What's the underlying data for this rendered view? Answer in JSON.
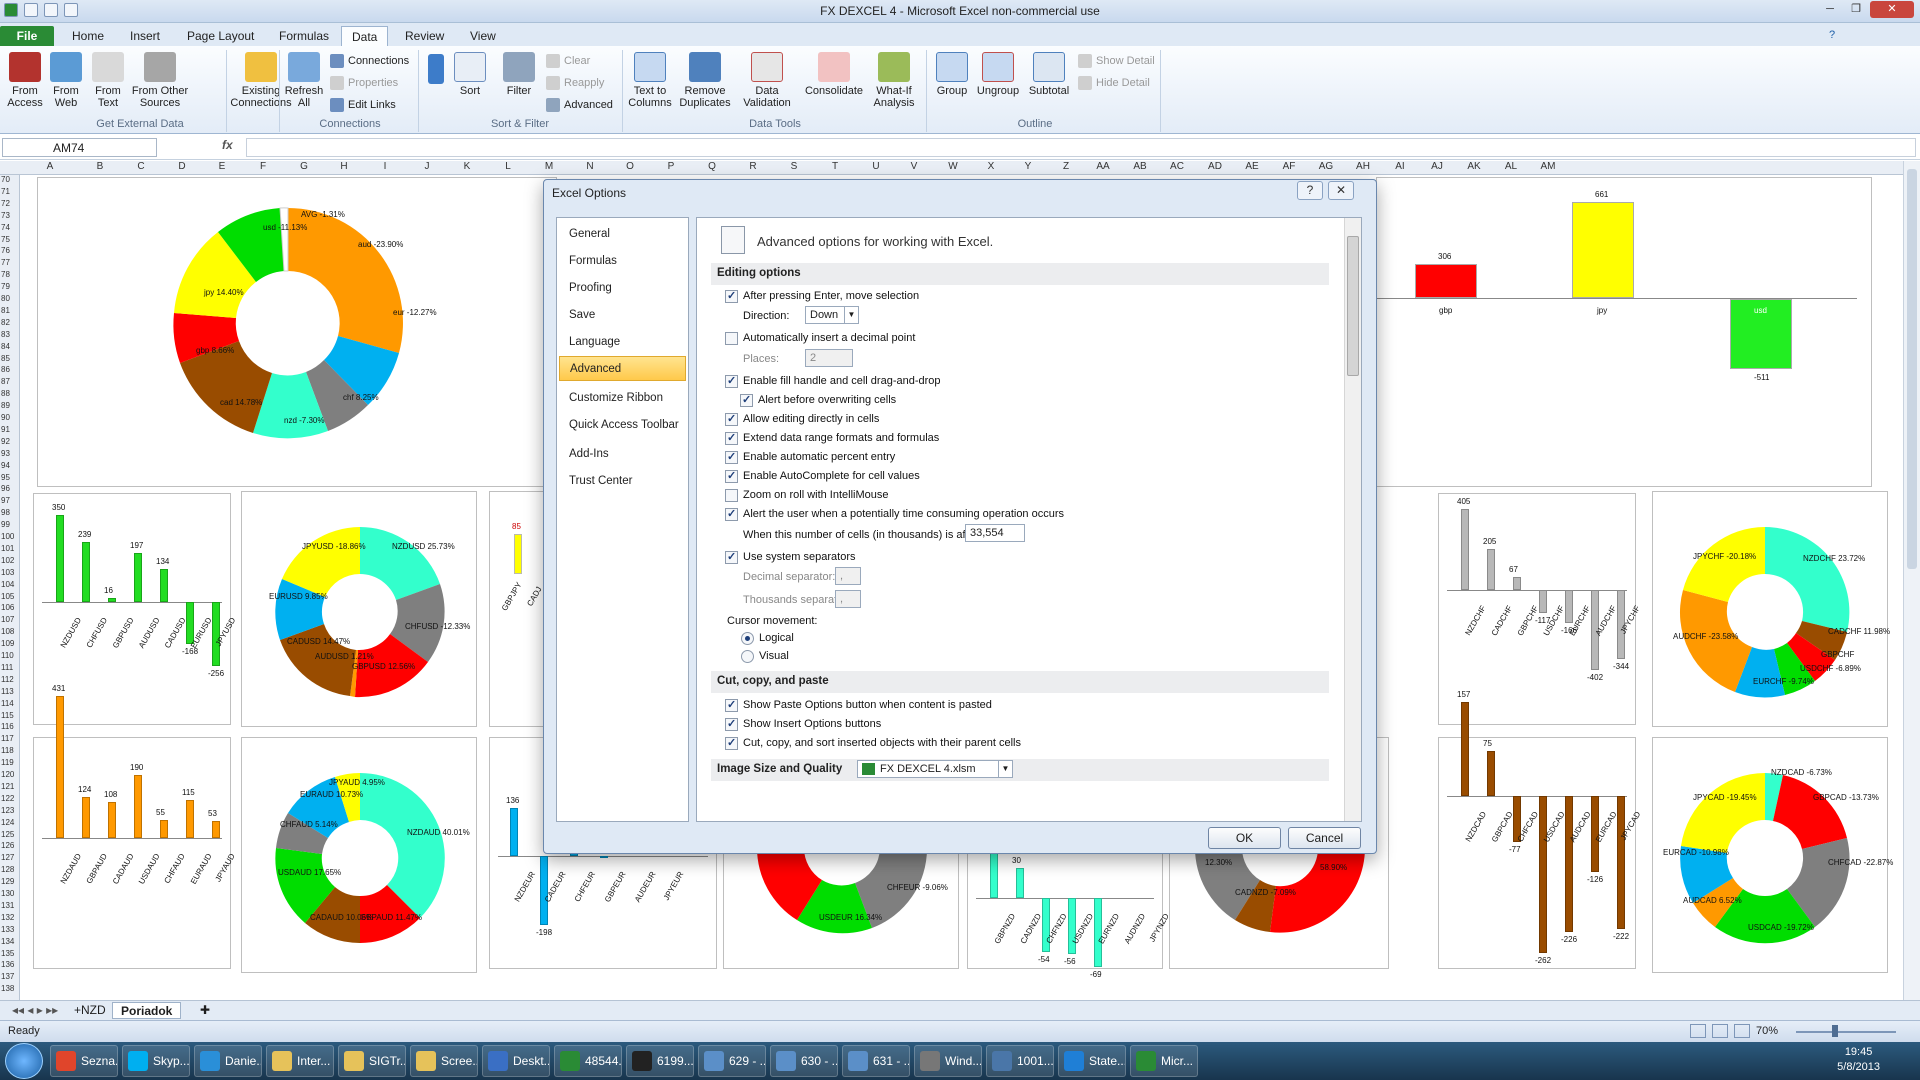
{
  "window": {
    "title": "FX DEXCEL 4  -  Microsoft Excel non-commercial use"
  },
  "tabs": [
    "File",
    "Home",
    "Insert",
    "Page Layout",
    "Formulas",
    "Data",
    "Review",
    "View"
  ],
  "ribbon": {
    "get_external": {
      "from_access": "From Access",
      "from_web": "From Web",
      "from_text": "From Text",
      "from_other": "From Other Sources",
      "group": "Get External Data"
    },
    "existing": "Existing Connections",
    "connections": {
      "refresh": "Refresh All",
      "connections": "Connections",
      "properties": "Properties",
      "edit_links": "Edit Links",
      "group": "Connections"
    },
    "sort_filter": {
      "sort": "Sort",
      "filter": "Filter",
      "clear": "Clear",
      "reapply": "Reapply",
      "advanced": "Advanced",
      "group": "Sort & Filter"
    },
    "data_tools": {
      "text_to_columns": "Text to Columns",
      "remove_duplicates": "Remove Duplicates",
      "data_validation": "Data Validation",
      "consolidate": "Consolidate",
      "what_if": "What-If Analysis",
      "group": "Data Tools"
    },
    "outline": {
      "group_btn": "Group",
      "ungroup": "Ungroup",
      "subtotal": "Subtotal",
      "show_detail": "Show Detail",
      "hide_detail": "Hide Detail",
      "group": "Outline"
    }
  },
  "formula_bar": {
    "name_box": "AM74",
    "fx": "fx",
    "value": ""
  },
  "columns": [
    "A",
    "B",
    "C",
    "D",
    "E",
    "F",
    "G",
    "H",
    "I",
    "J",
    "K",
    "L",
    "M",
    "N",
    "O",
    "P",
    "Q",
    "R",
    "S",
    "T",
    "U",
    "V",
    "W",
    "X",
    "Y",
    "Z",
    "AA",
    "AB",
    "AC",
    "AD",
    "AE",
    "AF",
    "AG",
    "AH",
    "AI",
    "AJ",
    "AK",
    "AL",
    "AM"
  ],
  "rows": [
    "70",
    "71",
    "72",
    "73",
    "74",
    "75",
    "76",
    "77",
    "78",
    "79",
    "80",
    "81",
    "82",
    "83",
    "84",
    "85",
    "86",
    "87",
    "88",
    "89",
    "90",
    "91",
    "92",
    "93",
    "94",
    "95",
    "96",
    "97",
    "98",
    "99",
    "100",
    "101",
    "102",
    "103",
    "104",
    "105",
    "106",
    "107",
    "108",
    "109",
    "110",
    "111",
    "112",
    "113",
    "114",
    "115",
    "116",
    "117",
    "118",
    "119",
    "120",
    "121",
    "122",
    "123",
    "124",
    "125",
    "126",
    "127",
    "128",
    "129",
    "130",
    "131",
    "132",
    "133",
    "134",
    "135",
    "136",
    "137",
    "138"
  ],
  "charts": {
    "main_pie": {
      "labels": [
        "aud -23.90%",
        "eur -12.27%",
        "chf 8.25%",
        "nzd -7.30%",
        "cad 14.78%",
        "gbp 8.66%",
        "jpy 14.40%",
        "usd -11.13%",
        "AVG -1.31%"
      ]
    },
    "top_right_bar": {
      "labels": [
        "306",
        "661",
        "gbp",
        "jpy",
        "usd",
        "-511"
      ]
    },
    "usd_bar": {
      "values": [
        "350",
        "239",
        "16",
        "197",
        "134",
        "-168",
        "-256"
      ],
      "cats": [
        "NZDUSD",
        "CHFUSD",
        "GBPUSD",
        "AUDUSD",
        "CADUSD",
        "EURUSD",
        "JPYUSD"
      ]
    },
    "usd_pie": {
      "labels": [
        "NZDUSD 25.73%",
        "CHFUSD -12.33%",
        "GBPUSD 12.56%",
        "AUDUSD 1.21%",
        "CADUSD 14.47%",
        "EURUSD 9.85%",
        "JPYUSD -18.86%"
      ]
    },
    "aud_bar": {
      "values": [
        "431",
        "124",
        "108",
        "190",
        "55",
        "115",
        "53"
      ],
      "cats": [
        "NZDAUD",
        "GBPAUD",
        "CADAUD",
        "USDAUD",
        "CHFAUD",
        "EURAUD",
        "JPYAUD"
      ]
    },
    "aud_pie": {
      "labels": [
        "JPYAUD 4.95%",
        "NZDAUD 40.01%",
        "GBPAUD 11.47%",
        "CADAUD 10.06%",
        "USDAUD 17.65%",
        "CHFAUD 5.14%",
        "EURAUD 10.73%"
      ]
    },
    "chf_bar": {
      "values": [
        "405",
        "205",
        "67",
        "-117",
        "-166",
        "-402",
        "-344"
      ],
      "cats": [
        "NZDCHF",
        "CADCHF",
        "GBPCHF",
        "USDCHF",
        "EURCHF",
        "AUDCHF",
        "JPYCHF"
      ]
    },
    "chf_pie": {
      "labels": [
        "JPYCHF -20.18%",
        "NZDCHF 23.72%",
        "CADCHF 11.98%",
        "GBPCHF",
        "USDCHF -6.89%",
        "EURCHF -9.74%",
        "AUDCHF -23.58%"
      ]
    },
    "cad_bar": {
      "values": [
        "157",
        "75",
        "-77",
        "-262",
        "-226",
        "-126",
        "-222"
      ],
      "cats": [
        "NZDCAD",
        "GBPCAD",
        "CHFCAD",
        "USDCAD",
        "AUDCAD",
        "EURCAD",
        "JPYCAD"
      ]
    },
    "cad_pie": {
      "labels": [
        "JPYCAD -19.45%",
        "NZDCAD -6.73%",
        "GBPCAD -13.73%",
        "CHFCAD -22.87%",
        "USDCAD -19.72%",
        "AUDCAD 6.52%",
        "EURCAD -10.98%"
      ]
    },
    "jpy_bar": {
      "labels": [
        "85",
        "GBPJPY",
        "CADJ"
      ]
    },
    "eur_bar": {
      "values": [
        "136",
        "-198",
        "12",
        "1"
      ],
      "cats": [
        "NZDEUR",
        "CADEUR",
        "CHFEUR",
        "GBPEUR",
        "AUDEUR",
        "JPYEUR"
      ]
    },
    "eur_pie": {
      "labels": [
        "CHFEUR -9.06%",
        "USDEUR 16.34%"
      ]
    },
    "nzd_bar": {
      "values": [
        "96",
        "30",
        "-54",
        "-56",
        "-69"
      ],
      "cats": [
        "GBPNZD",
        "CADNZD",
        "CHFNZD",
        "USDNZD",
        "EURNZD",
        "AUDNZD",
        "JPYNZD"
      ]
    },
    "nzd_pie": {
      "labels": [
        "12.30%",
        "CADNZD -7.09%",
        "58.90%"
      ]
    }
  },
  "dialog": {
    "title": "Excel Options",
    "help": "?",
    "close": "✕",
    "nav": [
      "General",
      "Formulas",
      "Proofing",
      "Save",
      "Language",
      "Advanced",
      "Customize Ribbon",
      "Quick Access Toolbar",
      "Add-Ins",
      "Trust Center"
    ],
    "header": "Advanced options for working with Excel.",
    "editing_section": "Editing options",
    "opt_after_enter": "After pressing Enter, move selection",
    "direction_label": "Direction:",
    "direction_value": "Down",
    "opt_decimal": "Automatically insert a decimal point",
    "places_label": "Places:",
    "places_value": "2",
    "opt_fill": "Enable fill handle and cell drag-and-drop",
    "opt_alert_overwrite": "Alert before overwriting cells",
    "opt_edit_direct": "Allow editing directly in cells",
    "opt_extend": "Extend data range formats and formulas",
    "opt_percent": "Enable automatic percent entry",
    "opt_autocomplete": "Enable AutoComplete for cell values",
    "opt_zoom": "Zoom on roll with IntelliMouse",
    "opt_alert_time": "Alert the user when a potentially time consuming operation occurs",
    "cells_label": "When this number of cells (in thousands) is affected:",
    "cells_value": "33,554",
    "opt_system_sep": "Use system separators",
    "decimal_sep_label": "Decimal separator:",
    "decimal_sep_value": ",",
    "thousands_sep_label": "Thousands separator:",
    "thousands_sep_value": ",",
    "cursor_label": "Cursor movement:",
    "cursor_logical": "Logical",
    "cursor_visual": "Visual",
    "ccp_section": "Cut, copy, and paste",
    "opt_paste_options": "Show Paste Options button when content is pasted",
    "opt_insert_options": "Show Insert Options buttons",
    "opt_cut_copy_sort": "Cut, copy, and sort inserted objects with their parent cells",
    "image_section": "Image Size and Quality",
    "image_file": "FX DEXCEL 4.xlsm",
    "ok": "OK",
    "cancel": "Cancel"
  },
  "sheet_tabs": [
    "+NZD",
    "Poriadok"
  ],
  "status": {
    "ready": "Ready",
    "zoom": "70%"
  },
  "taskbar": {
    "items": [
      "Sezna...",
      "Skyp...",
      "Danie...",
      "Inter...",
      "SIGTr...",
      "Scree...",
      "Deskt...",
      "48544...",
      "6199...",
      "629 - ...",
      "630 - ...",
      "631 - ...",
      "Wind...",
      "1001...",
      "State...",
      "Micr..."
    ],
    "time": "19:45",
    "date": "5/8/2013"
  },
  "colors": {
    "aud": "#ff9900",
    "eur": "#00b0f0",
    "chf": "#7f7f7f",
    "nzd": "#33ffcc",
    "cad": "#994c00",
    "gbp": "#ff0000",
    "jpy": "#ffff00",
    "usd": "#00dd00"
  }
}
